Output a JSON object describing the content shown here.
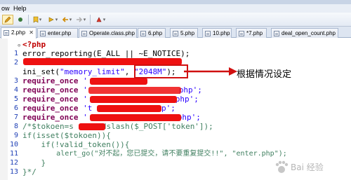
{
  "menu": {
    "items": [
      "ow",
      "Help"
    ]
  },
  "tabs": [
    "2.php",
    "enter.php",
    "Operate.class.php",
    "6.php",
    "5.php",
    "10.php",
    "*7.php",
    "deal_open_count.php"
  ],
  "code": {
    "line_numbers": [
      "1",
      "2",
      "3",
      "4",
      "5",
      "6",
      "7",
      "8",
      "9",
      "10",
      "11",
      "12",
      "13"
    ],
    "l1": "<?php",
    "l2": "error_reporting(E_ALL || ~E_NOTICE);",
    "l3_fn": "ini_set(",
    "l3_arg1": "\"memory_limit\"",
    "l3_sep": ", ",
    "l3_arg2": "\"2048M\"",
    "l3_end": ");",
    "require_kw": "require_once",
    "l4_str": "'",
    "l5_str": "'",
    "l5_tail": "php';",
    "l6_str": "'",
    "l6_tail": "php';",
    "l7_str": "'t",
    "l7_tail": "hp';",
    "l8_str": "'",
    "l8_tail": "php';",
    "l9": "/*$tokoen=s",
    "l9_tail": "dslash($_POST['token']);",
    "l10_kw": "if",
    "l10_rest": "(isset($tokoen)){",
    "l11_kw": "if",
    "l11_rest": "(!valid_token()){",
    "l12_fn": "alert_go(",
    "l12_str1": "\"对不起，您已提交，请不要重复提交!!\"",
    "l12_sep": ", ",
    "l12_str2": "\"enter.php\"",
    "l12_end": ");",
    "l13": "}",
    "l14": "}*/"
  },
  "annotation": {
    "text": "根据情况设定",
    "color": "#d01010"
  },
  "watermark": {
    "text": "Bai 经验"
  },
  "colors": {
    "keyword": "#7f0055",
    "string": "#2a00ff",
    "comment": "#3f7f5f",
    "php_tag": "#c00000",
    "line_number": "#1e3fb5",
    "redaction": "#ee1111"
  }
}
